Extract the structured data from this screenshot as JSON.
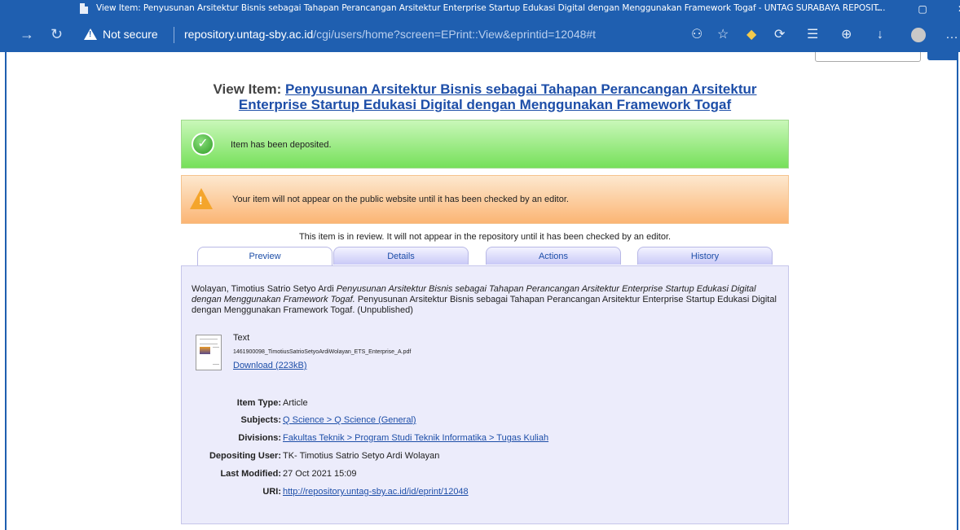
{
  "browser": {
    "tab_title": "View Item: Penyusunan Arsitektur Bisnis sebagai Tahapan Perancangan Arsitektur Enterprise Startup Edukasi Digital dengan Menggunakan Framework Togaf - UNTAG SURABAYA REPOSIT...",
    "security_label": "Not secure",
    "url_host": "repository.untag-sby.ac.id",
    "url_path": "/cgi/users/home?screen=EPrint::View&eprintid=12048#t",
    "window_buttons": [
      "–",
      "▢",
      "✕"
    ]
  },
  "page": {
    "heading_prefix": "View Item:",
    "heading_title": "Penyusunan Arsitektur Bisnis sebagai Tahapan Perancangan Arsitektur Enterprise Startup Edukasi Digital dengan Menggunakan Framework Togaf",
    "success_message": "Item has been deposited.",
    "warning_message": "Your item will not appear on the public website until it has been checked by an editor.",
    "review_note": "This item is in review. It will not appear in the repository until it has been checked by an editor."
  },
  "tabs": [
    {
      "label": "Preview",
      "active": true
    },
    {
      "label": "Details",
      "active": false
    },
    {
      "label": "Actions",
      "active": false
    },
    {
      "label": "History",
      "active": false
    }
  ],
  "citation": {
    "author": "Wolayan, Timotius Satrio Setyo Ardi",
    "title_italic": "Penyusunan Arsitektur Bisnis sebagai Tahapan Perancangan Arsitektur Enterprise Startup Edukasi Digital dengan Menggunakan Framework Togaf.",
    "rest": "Penyusunan Arsitektur Bisnis sebagai Tahapan Perancangan Arsitektur Enterprise Startup Edukasi Digital dengan Menggunakan Framework Togaf. (Unpublished)"
  },
  "file": {
    "type": "Text",
    "name": "1461900098_TimotiusSatrioSetyoArdiWolayan_ETS_Enterprise_A.pdf",
    "download_label": "Download (223kB)"
  },
  "metadata": {
    "item_type": {
      "label": "Item Type:",
      "value": "Article"
    },
    "subjects": {
      "label": "Subjects:",
      "value": "Q Science > Q Science (General)"
    },
    "divisions": {
      "label": "Divisions:",
      "value": "Fakultas Teknik > Program Studi Teknik Informatika > Tugas Kuliah"
    },
    "depositing_user": {
      "label": "Depositing User:",
      "value": "TK- Timotius Satrio Setyo Ardi Wolayan"
    },
    "last_modified": {
      "label": "Last Modified:",
      "value": "27 Oct 2021 15:09"
    },
    "uri": {
      "label": "URI:",
      "value": "http://repository.untag-sby.ac.id/id/eprint/12048"
    }
  }
}
